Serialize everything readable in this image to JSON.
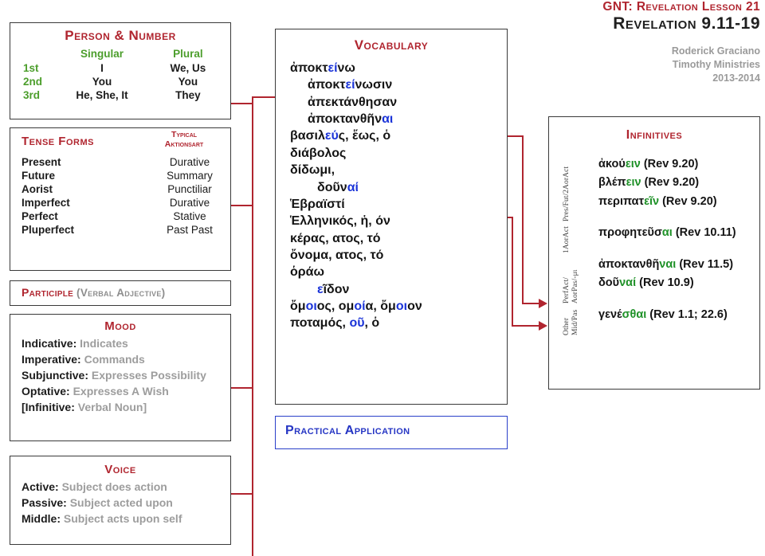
{
  "title_block": {
    "lesson": "GNT: Revelation Lesson 21",
    "passage": "Revelation 9.11-19",
    "author": "Roderick Graciano",
    "organization": "Timothy Ministries",
    "years": "2013-2014"
  },
  "person_number": {
    "title": "Person & Number",
    "columns": [
      "",
      "Singular",
      "Plural"
    ],
    "rows": [
      {
        "person": "1st",
        "singular": "I",
        "plural": "We, Us"
      },
      {
        "person": "2nd",
        "singular": "You",
        "plural": "You"
      },
      {
        "person": "3rd",
        "singular": "He, She, It",
        "plural": "They"
      }
    ]
  },
  "tense_forms": {
    "title": "Tense Forms",
    "aktionsart_header_line1": "Typical",
    "aktionsart_header_line2": "Aktionsart",
    "rows": [
      {
        "tense": "Present",
        "aktionsart": "Durative"
      },
      {
        "tense": "Future",
        "aktionsart": "Summary"
      },
      {
        "tense": "Aorist",
        "aktionsart": "Punctiliar"
      },
      {
        "tense": "Imperfect",
        "aktionsart": "Durative"
      },
      {
        "tense": "Perfect",
        "aktionsart": "Stative"
      },
      {
        "tense": "Pluperfect",
        "aktionsart": "Past Past"
      }
    ]
  },
  "participle": {
    "label": "Participle",
    "gloss": "(Verbal Adjective)"
  },
  "mood": {
    "title": "Mood",
    "entries": [
      {
        "key": "Indicative:",
        "value": "Indicates"
      },
      {
        "key": "Imperative:",
        "value": "Commands"
      },
      {
        "key": "Subjunctive:",
        "value": "Expresses Possibility"
      },
      {
        "key": "Optative:",
        "value": "Expresses A Wish"
      },
      {
        "key": "[Infinitive:",
        "value": "Verbal Noun]"
      }
    ]
  },
  "voice": {
    "title": "Voice",
    "entries": [
      {
        "key": "Active:",
        "value": "Subject does action"
      },
      {
        "key": "Passive:",
        "value": "Subject acted upon"
      },
      {
        "key": "Middle:",
        "value": "Subject acts upon self"
      }
    ]
  },
  "vocabulary": {
    "title": "Vocabulary",
    "entries": [
      {
        "indent": 0,
        "pre": "ἀποκτ",
        "hi": "εί",
        "post": "νω"
      },
      {
        "indent": 1,
        "pre": "ἀποκτ",
        "hi": "εί",
        "post": "νωσιν"
      },
      {
        "indent": 1,
        "pre": "ἀπεκτάνθησαν",
        "hi": "",
        "post": ""
      },
      {
        "indent": 1,
        "pre": "ἀποκτανθῆν",
        "hi": "αι",
        "post": ""
      },
      {
        "indent": 0,
        "pre": "βασιλ",
        "hi": "εύ",
        "post": "ς, ἕως, ὁ"
      },
      {
        "indent": 0,
        "pre": "διάβολος",
        "hi": "",
        "post": ""
      },
      {
        "indent": 0,
        "pre": "δίδωμι,",
        "hi": "",
        "post": ""
      },
      {
        "indent": 2,
        "pre": "δοῦν",
        "hi": "αί",
        "post": ""
      },
      {
        "indent": 0,
        "pre": "Ἑβραϊστί",
        "hi": "",
        "post": ""
      },
      {
        "indent": 0,
        "pre": "Ἑλληνικός, ἡ, όν",
        "hi": "",
        "post": ""
      },
      {
        "indent": 0,
        "pre": "κέρας, ατος, τό",
        "hi": "",
        "post": ""
      },
      {
        "indent": 0,
        "pre": "ὄνομα, ατος, τό",
        "hi": "",
        "post": ""
      },
      {
        "indent": 0,
        "pre": "ὁράω",
        "hi": "",
        "post": ""
      },
      {
        "indent": 2,
        "pre": "",
        "hi": "ε",
        "post": "ῖδον"
      },
      {
        "indent": 0,
        "pre": "ὄμ",
        "hi": "οι",
        "post": "ος, ομ",
        "hi2": "οί",
        "post2": "α, ὄμ",
        "hi3": "οι",
        "post3": "ον"
      },
      {
        "indent": 0,
        "pre": "ποταμός, ",
        "hi": "οῦ",
        "post": ", ὁ"
      }
    ]
  },
  "practical_application": {
    "title": "Practical Application"
  },
  "infinitives": {
    "title": "Infinitives",
    "groups": [
      {
        "side_label_lines": [
          "Pres/Fut/2AorAct"
        ],
        "lines": [
          {
            "pre": "ἀκού",
            "hi": "ειν",
            "ref": " (Rev 9.20)"
          },
          {
            "pre": "βλέπ",
            "hi": "ειν",
            "ref": " (Rev 9.20)"
          },
          {
            "pre": "περιπατ",
            "hi": "εῖν",
            "ref": " (Rev 9.20)"
          }
        ]
      },
      {
        "side_label_lines": [
          "1AorAct"
        ],
        "lines": [
          {
            "pre": "προφητεῦσ",
            "hi": "αι",
            "ref": " (Rev 10.11)"
          }
        ]
      },
      {
        "side_label_lines": [
          "PerfAct/",
          "AorPas/-μι"
        ],
        "lines": [
          {
            "pre": "ἀποκτανθῆ",
            "hi": "ναι",
            "ref": " (Rev 11.5)"
          },
          {
            "pre": "δοῦ",
            "hi": "ναί",
            "ref": " (Rev 10.9)"
          }
        ]
      },
      {
        "side_label_lines": [
          "Other",
          "Mid/Pas"
        ],
        "lines": [
          {
            "pre": "γενέ",
            "hi": "σθαι",
            "ref": " (Rev 1.1; 22.6)"
          }
        ]
      }
    ]
  },
  "colors": {
    "accent_red": "#b0252f",
    "green": "#4c9e2c",
    "highlight_blue": "#1b34d8",
    "highlight_green": "#1e9127",
    "gray_text": "#9d9d9d",
    "blue_border": "#2a3fc9"
  }
}
